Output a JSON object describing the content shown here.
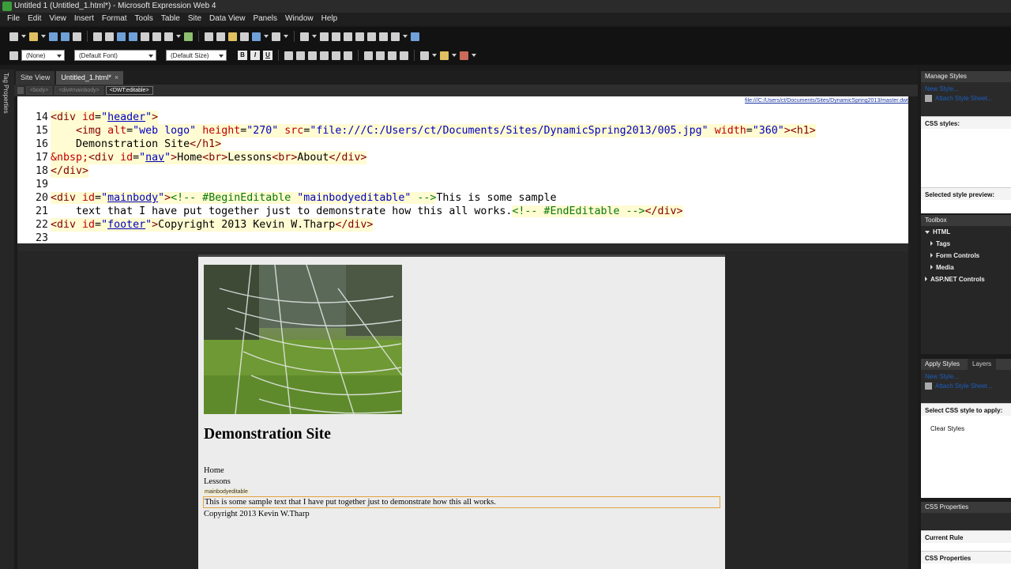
{
  "window": {
    "title": "Untitled 1 (Untitled_1.html*) - Microsoft Expression Web 4"
  },
  "menu": [
    "File",
    "Edit",
    "View",
    "Insert",
    "Format",
    "Tools",
    "Table",
    "Site",
    "Data View",
    "Panels",
    "Window",
    "Help"
  ],
  "format_toolbar": {
    "style_select": "(None)",
    "font_select": "(Default Font)",
    "size_select": "(Default Size)",
    "bold": "B",
    "italic": "I",
    "underline": "U"
  },
  "left_strip": {
    "label": "Tag Properties"
  },
  "doc_tabs": [
    {
      "label": "Site View",
      "active": false
    },
    {
      "label": "Untitled_1.html*",
      "active": true,
      "close": "×"
    }
  ],
  "quick_tag": [
    "<body>",
    "<div#mainbody>",
    "<DWT:editable>"
  ],
  "code": {
    "file_path": "file:///C:/Users/ct/Documents/Sites/DynamicSpring2013/master.dwt",
    "line_numbers": [
      "14",
      "15",
      "16",
      "17",
      "18",
      "19",
      "20",
      "21",
      "22",
      "23"
    ]
  },
  "design": {
    "site_title": "Demonstration Site",
    "nav_items": [
      "Home",
      "Lessons",
      "About"
    ],
    "editable_label": "mainbodyeditable",
    "editable_text": "This is some sample text that I have put together just to demonstrate how this all works.",
    "footer": "Copyright 2013 Kevin W.Tharp"
  },
  "panels": {
    "manage_styles": {
      "title": "Manage Styles",
      "new_style": "New Style...",
      "attach": "Attach Style Sheet...",
      "css_styles": "CSS styles:",
      "preview": "Selected style preview:"
    },
    "toolbox": {
      "title": "Toolbox",
      "items": [
        "HTML",
        "Tags",
        "Form Controls",
        "Media",
        "ASP.NET Controls"
      ]
    },
    "apply_styles": {
      "tabs": [
        "Apply Styles",
        "Layers"
      ],
      "new_style": "New Style...",
      "attach": "Attach Style Sheet...",
      "select_label": "Select CSS style to apply:",
      "clear": "Clear Styles"
    },
    "css_properties": {
      "title": "CSS Properties",
      "current_rule": "Current Rule",
      "sub": "CSS Properties"
    }
  }
}
